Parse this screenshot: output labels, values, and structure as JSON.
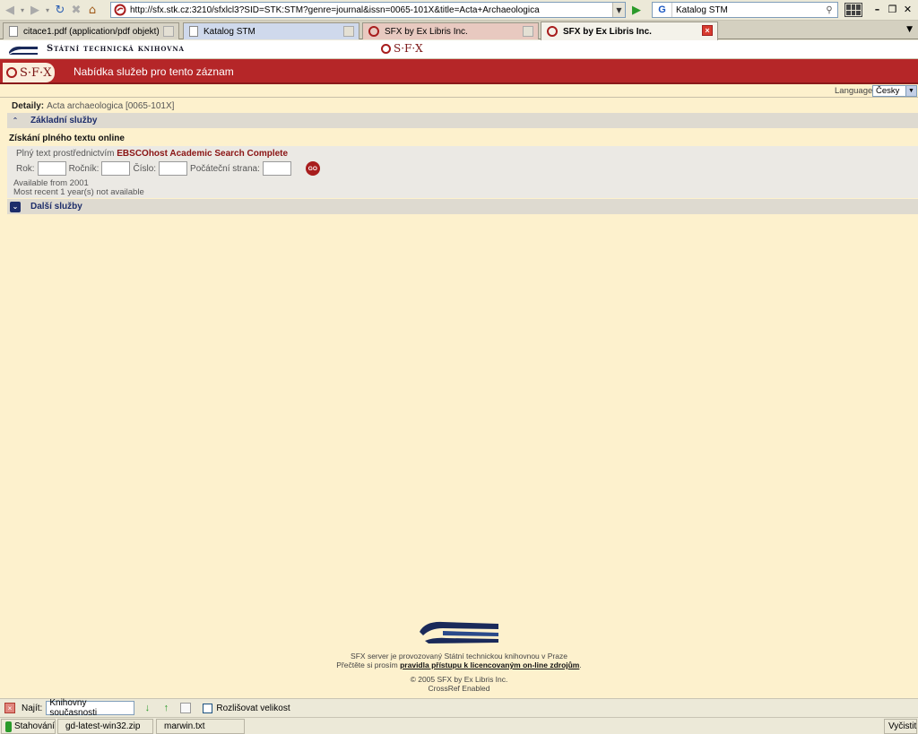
{
  "browser": {
    "url": "http://sfx.stk.cz:3210/sfxlcl3?SID=STK:STM?genre=journal&issn=0065-101X&title=Acta+Archaeologica",
    "search_engine": "G",
    "search_text": "Katalog STM",
    "tabs": [
      {
        "label": "citace1.pdf (application/pdf objekt)"
      },
      {
        "label": "Katalog STM"
      },
      {
        "label": "SFX by Ex Libris Inc."
      },
      {
        "label": "SFX by Ex Libris Inc."
      }
    ]
  },
  "header": {
    "library_name": "Státní technická knihovna",
    "sfx_logo_text": "S·F·X",
    "page_title": "Nabídka služeb pro tento záznam",
    "language_label": "Language",
    "language_value": "Česky"
  },
  "details": {
    "label": "Detaily:",
    "value": "Acta archaeologica [0065-101X]"
  },
  "sections": {
    "basic": "Základní služby",
    "other": "Další služby"
  },
  "fulltext": {
    "title": "Získání plného textu online",
    "provider_prefix": "Plný text prostřednictvím",
    "provider_link": "EBSCOhost Academic Search Complete",
    "fields": {
      "year": "Rok:",
      "volume": "Ročník:",
      "issue": "Číslo:",
      "start_page": "Počáteční strana:"
    },
    "go_label": "GO",
    "available_from": "Available from 2001",
    "embargo": "Most recent 1 year(s) not available"
  },
  "footer": {
    "line1": "SFX server je provozovaný Státní technickou knihovnou v Praze",
    "line2_prefix": "Přečtěte si prosím",
    "line2_link": "pravidla přístupu k licencovaným on-line zdrojům",
    "line2_suffix": ".",
    "line3": "© 2005 SFX by Ex Libris Inc.",
    "line4": "CrossRef Enabled"
  },
  "findbar": {
    "label": "Najít:",
    "value": "Knihovny současnosti",
    "match_case": "Rozlišovat velikost"
  },
  "statusbar": {
    "downloads": "Stahování",
    "file1": "gd-latest-win32.zip",
    "file2": "marwin.txt",
    "clear": "Vyčistit"
  }
}
